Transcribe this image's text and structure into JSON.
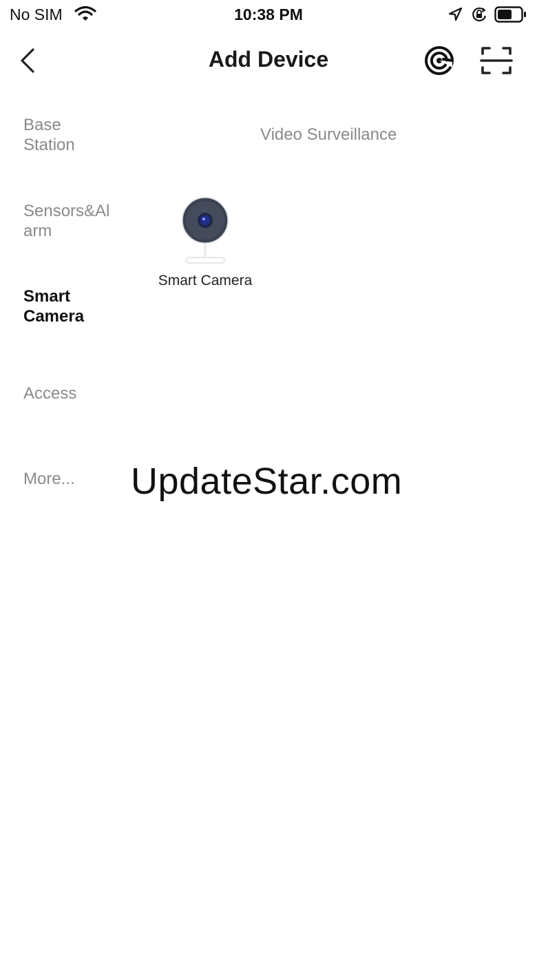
{
  "status_bar": {
    "carrier": "No SIM",
    "time": "10:38 PM"
  },
  "header": {
    "title": "Add Device"
  },
  "sidebar": {
    "items": [
      {
        "label": "Base Station",
        "line1": "Base",
        "line2": "Station",
        "active": false
      },
      {
        "label": "Sensors&Alarm",
        "line1": "Sensors&Al",
        "line2": "arm",
        "active": false
      },
      {
        "label": "Smart Camera",
        "line1": "Smart",
        "line2": "Camera",
        "active": true
      },
      {
        "label": "Access",
        "line1": "Access",
        "line2": "",
        "active": false
      },
      {
        "label": "More...",
        "line1": "More...",
        "line2": "",
        "active": false
      }
    ]
  },
  "content": {
    "section_title": "Video Surveillance",
    "devices": [
      {
        "label": "Smart Camera",
        "icon": "smart-camera-icon"
      }
    ]
  },
  "watermark": "UpdateStar.com",
  "colors": {
    "background": "#ffffff",
    "text_primary": "#111111",
    "text_secondary": "#8a8a8a",
    "camera_body": "#3b4150",
    "camera_lens": "#1f2f8c"
  }
}
